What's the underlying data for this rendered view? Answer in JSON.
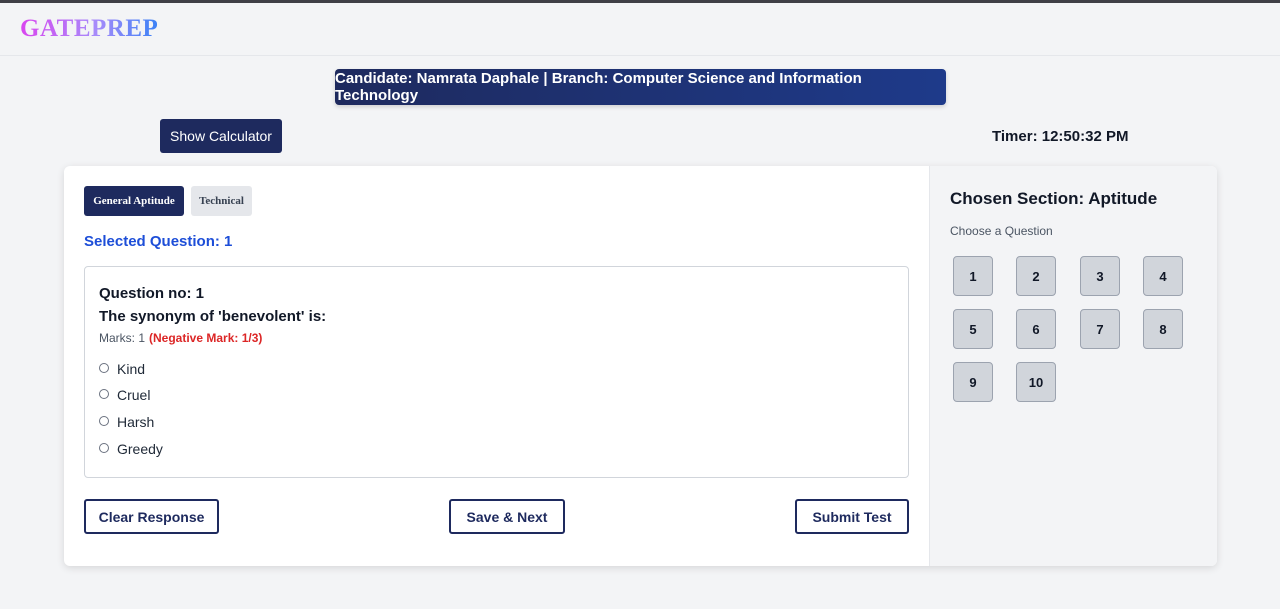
{
  "app": {
    "logo": "GATEPREP"
  },
  "candidate_banner": "Candidate: Namrata Daphale | Branch: Computer Science and Information Technology",
  "toolbar": {
    "calculator_label": "Show Calculator",
    "timer": "Timer: 12:50:32 PM"
  },
  "tabs": [
    {
      "label": "General Aptitude",
      "active": true
    },
    {
      "label": "Technical",
      "active": false
    }
  ],
  "selected_question": "Selected Question: 1",
  "question": {
    "number": "Question no: 1",
    "text": "The synonym of 'benevolent' is:",
    "marks": "Marks: 1",
    "negative": "(Negative Mark: 1/3)",
    "options": [
      "Kind",
      "Cruel",
      "Harsh",
      "Greedy"
    ]
  },
  "actions": {
    "clear": "Clear Response",
    "save_next": "Save & Next",
    "submit": "Submit Test"
  },
  "panel": {
    "title": "Chosen Section: Aptitude",
    "subtitle": "Choose a Question",
    "questions": [
      "1",
      "2",
      "3",
      "4",
      "5",
      "6",
      "7",
      "8",
      "9",
      "10"
    ]
  },
  "colors": {
    "primary": "#1e2a5e",
    "link_blue": "#1d4ed8",
    "negative_red": "#dc2626"
  }
}
